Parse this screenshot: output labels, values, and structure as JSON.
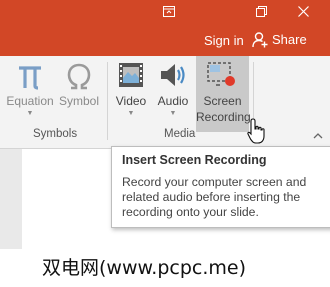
{
  "colors": {
    "accent": "#d24726",
    "ribbon_bg": "#f3f3f3"
  },
  "window": {
    "icons": [
      "ribbon-display-options-icon",
      "restore-icon",
      "close-icon"
    ]
  },
  "account": {
    "signin_label": "Sign in",
    "share_label": "Share"
  },
  "ribbon": {
    "symbols_group": {
      "label": "Symbols",
      "equation_label": "Equation",
      "symbol_label": "Symbol"
    },
    "media_group": {
      "label": "Media",
      "video_label": "Video",
      "audio_label": "Audio",
      "screen_recording_line1": "Screen",
      "screen_recording_line2": "Recording"
    }
  },
  "tooltip": {
    "title": "Insert Screen Recording",
    "description": "Record your computer screen and related audio before inserting the recording onto your slide."
  },
  "watermark": {
    "text": "双电网(www.pcpc.me)"
  }
}
